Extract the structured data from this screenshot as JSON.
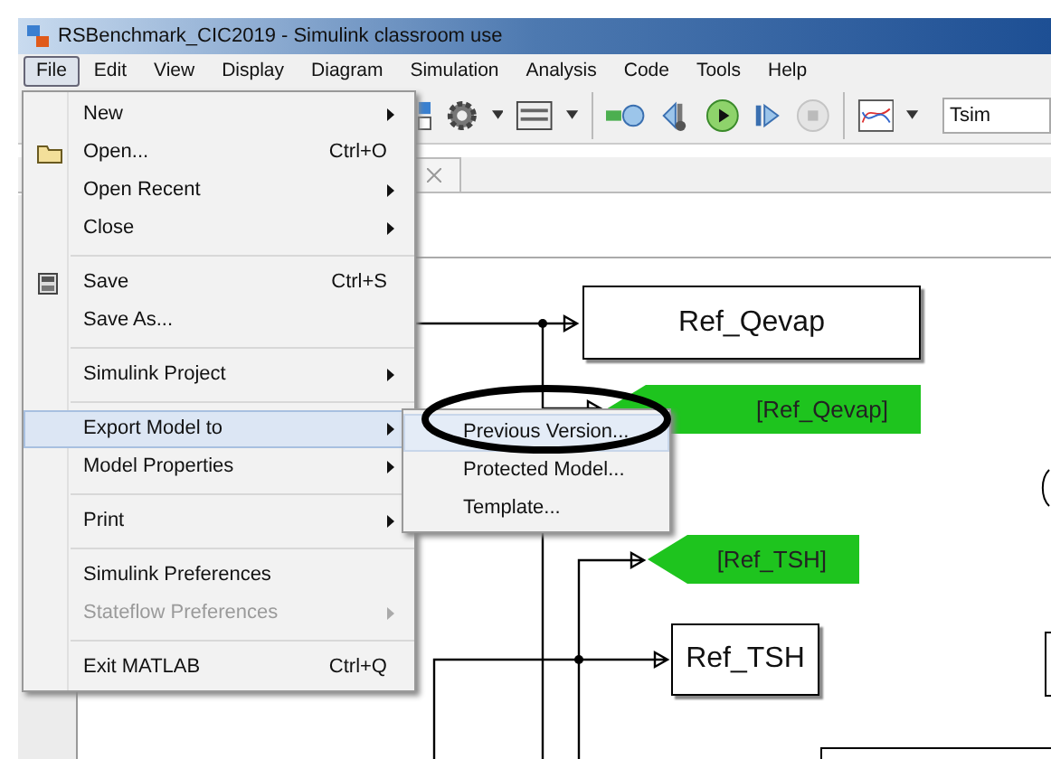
{
  "window": {
    "title": "RSBenchmark_CIC2019 - Simulink classroom use"
  },
  "menubar": [
    {
      "label": "File",
      "selected": true
    },
    {
      "label": "Edit",
      "selected": false
    },
    {
      "label": "View",
      "selected": false
    },
    {
      "label": "Display",
      "selected": false
    },
    {
      "label": "Diagram",
      "selected": false
    },
    {
      "label": "Simulation",
      "selected": false
    },
    {
      "label": "Analysis",
      "selected": false
    },
    {
      "label": "Code",
      "selected": false
    },
    {
      "label": "Tools",
      "selected": false
    },
    {
      "label": "Help",
      "selected": false
    }
  ],
  "toolbar": {
    "stop_time": "Tsim"
  },
  "file_menu": {
    "sections": [
      [
        {
          "label": "New",
          "submenu": true,
          "disabled": false,
          "selected": false
        },
        {
          "label": "Open...",
          "shortcut": "Ctrl+O",
          "submenu": false,
          "disabled": false,
          "selected": false
        },
        {
          "label": "Open Recent",
          "submenu": true,
          "disabled": false,
          "selected": false
        },
        {
          "label": "Close",
          "submenu": true,
          "disabled": false,
          "selected": false
        }
      ],
      [
        {
          "label": "Save",
          "shortcut": "Ctrl+S",
          "submenu": false,
          "disabled": false,
          "selected": false
        },
        {
          "label": "Save As...",
          "submenu": false,
          "disabled": false,
          "selected": false
        }
      ],
      [
        {
          "label": "Simulink Project",
          "submenu": true,
          "disabled": false,
          "selected": false
        }
      ],
      [
        {
          "label": "Export Model to",
          "submenu": true,
          "disabled": false,
          "selected": true
        },
        {
          "label": "Model Properties",
          "submenu": true,
          "disabled": false,
          "selected": false
        }
      ],
      [
        {
          "label": "Print",
          "submenu": true,
          "disabled": false,
          "selected": false
        }
      ],
      [
        {
          "label": "Simulink Preferences",
          "submenu": false,
          "disabled": false,
          "selected": false
        },
        {
          "label": "Stateflow Preferences",
          "submenu": true,
          "disabled": true,
          "selected": false
        }
      ],
      [
        {
          "label": "Exit MATLAB",
          "shortcut": "Ctrl+Q",
          "submenu": false,
          "disabled": false,
          "selected": false
        }
      ]
    ]
  },
  "export_submenu": [
    {
      "label": "Previous Version...",
      "selected": true,
      "circled": true
    },
    {
      "label": "Protected Model...",
      "selected": false,
      "circled": false
    },
    {
      "label": "Template...",
      "selected": false,
      "circled": false
    }
  ],
  "diagram": {
    "blocks": [
      {
        "kind": "block",
        "label": "Ref_Qevap"
      },
      {
        "kind": "goto",
        "label": "[Ref_Qevap]"
      },
      {
        "kind": "goto",
        "label": "[Ref_TSH]"
      },
      {
        "kind": "block",
        "label": "Ref_TSH"
      }
    ]
  }
}
